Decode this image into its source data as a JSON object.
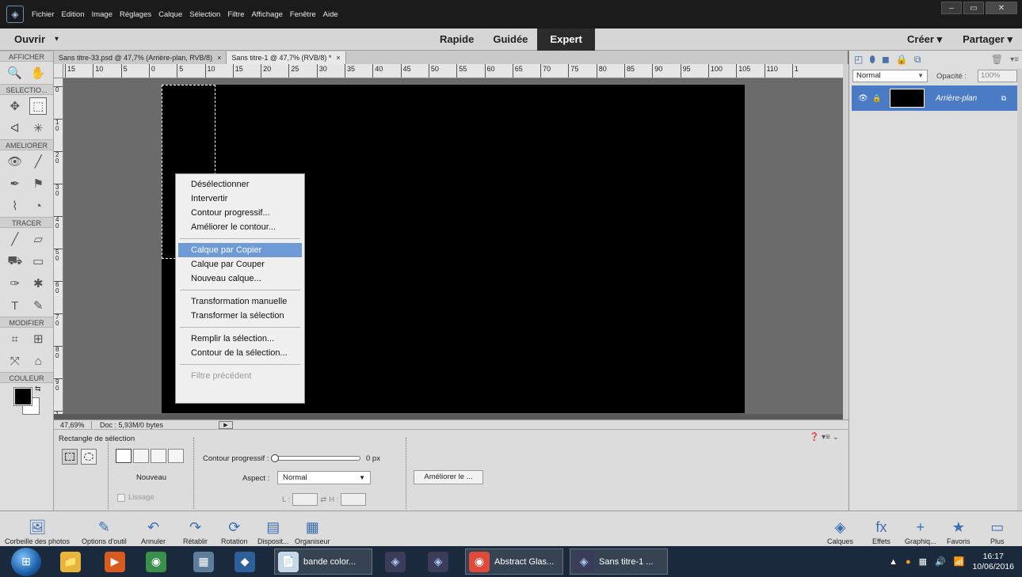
{
  "menubar": {
    "items": [
      "Fichier",
      "Edition",
      "Image",
      "Réglages",
      "Calque",
      "Sélection",
      "Filtre",
      "Affichage",
      "Fenêtre",
      "Aide"
    ],
    "window_controls": [
      "–",
      "▭",
      "✕"
    ]
  },
  "modebar": {
    "open_label": "Ouvrir",
    "tabs": [
      "Rapide",
      "Guidée",
      "Expert"
    ],
    "active_tab": "Expert",
    "create_label": "Créer",
    "share_label": "Partager"
  },
  "toolbox": {
    "sections": {
      "view": "AFFICHER",
      "select": "SELECTIO...",
      "enhance": "AMELIORER",
      "draw": "TRACER",
      "modify": "MODIFIER",
      "color": "COULEUR"
    },
    "icons": {
      "zoom": "🔍",
      "hand": "✋",
      "move": "✥",
      "marquee": "⬚",
      "lasso": "ᐊ",
      "magic_wand": "✳",
      "red_eye": "👁",
      "spot_heal": "╱",
      "smart_brush": "✒",
      "stamp": "⚑",
      "blur": "⌇",
      "sponge": "◔",
      "brush": "╱",
      "eraser": "▱",
      "paint_bucket": "⛟",
      "gradient": "▭",
      "eyedropper": "✑",
      "custom_shape": "✱",
      "text": "T",
      "pencil": "✎",
      "crop": "⌗",
      "recompose": "⊞",
      "straighten": "⤧",
      "content_move": "⌂",
      "swap_colors": "⇆"
    },
    "fg_color": "#000000",
    "bg_color": "#ffffff"
  },
  "document_tabs": [
    {
      "label": "Sans titre-33.psd @ 47,7% (Arrière-plan, RVB/8)",
      "close": "×"
    },
    {
      "label": "Sans titre-1 @ 47,7% (RVB/8) *",
      "close": "×"
    }
  ],
  "ruler": {
    "h_labels": [
      "15",
      "10",
      "5",
      "0",
      "5",
      "10",
      "15",
      "20",
      "25",
      "30",
      "35",
      "40",
      "45",
      "50",
      "55",
      "60",
      "65",
      "70",
      "75",
      "80",
      "85",
      "90",
      "95",
      "100",
      "105",
      "110",
      "1"
    ],
    "v_labels": [
      "0",
      "1\n0",
      "2\n0",
      "3\n0",
      "4\n0",
      "5\n0",
      "6\n0",
      "7\n0",
      "8\n0",
      "9\n0",
      "1"
    ]
  },
  "context_menu": {
    "groups": [
      [
        "Désélectionner",
        "Intervertir",
        "Contour progressif...",
        "Améliorer le contour..."
      ],
      [
        "Calque par Copier",
        "Calque par Couper",
        "Nouveau calque..."
      ],
      [
        "Transformation manuelle",
        "Transformer la sélection"
      ],
      [
        "Remplir la sélection...",
        "Contour de la sélection..."
      ],
      [
        "Filtre précédent"
      ]
    ],
    "highlighted": "Calque par Copier",
    "disabled": "Filtre précédent"
  },
  "statusbar": {
    "zoom": "47,69%",
    "doc": "Doc : 5,93M/0 bytes",
    "arrow": "▶"
  },
  "options": {
    "title": "Rectangle de sélection",
    "help_icons": "❓ ▾≡ ⌄",
    "mode_label": "Nouveau",
    "smoothing_label": "Lissage",
    "feather_label": "Contour progressif :",
    "feather_value": "0 px",
    "aspect_label": "Aspect :",
    "aspect_value": "Normal",
    "w_label": "L :",
    "h_label": "H :",
    "swap": "⇄",
    "refine_button": "Améliorer le ..."
  },
  "layers_panel": {
    "icons": [
      "◰",
      "⬮",
      "◼",
      "🔒",
      "⧉"
    ],
    "trash": "🗑",
    "menu": "▾≡",
    "blend_mode": "Normal",
    "opacity_label": "Opacité :",
    "opacity_value": "100%",
    "layer": {
      "name": "Arrière-plan",
      "eye": "👁",
      "lock": "🔒",
      "badge": "⧉"
    }
  },
  "bottombar": {
    "left": [
      {
        "label": "Corbeille des photos",
        "icon": "🖼"
      },
      {
        "label": "Options d'outil",
        "icon": "✎"
      },
      {
        "label": "Annuler",
        "icon": "↶"
      },
      {
        "label": "Rétablir",
        "icon": "↷"
      },
      {
        "label": "Rotation",
        "icon": "⟳"
      },
      {
        "label": "Disposit...",
        "icon": "▤"
      },
      {
        "label": "Organiseur",
        "icon": "▦"
      }
    ],
    "right": [
      {
        "label": "Calques",
        "icon": "◈"
      },
      {
        "label": "Effets",
        "icon": "fx"
      },
      {
        "label": "Graphiq...",
        "icon": "+"
      },
      {
        "label": "Favoris",
        "icon": "★"
      },
      {
        "label": "Plus",
        "icon": "▭"
      }
    ]
  },
  "taskbar": {
    "start_icon": "⊞",
    "apps": [
      {
        "icon": "📁",
        "bg": "#e8b53a"
      },
      {
        "icon": "▶",
        "bg": "#d95b1f"
      },
      {
        "icon": "◉",
        "bg": "#3a8f4a"
      },
      {
        "icon": "▦",
        "bg": "#5d7d9a"
      },
      {
        "icon": "◆",
        "bg": "#2d5f9a"
      }
    ],
    "labeled": [
      {
        "label": "bande color...",
        "icon": "📄"
      },
      {
        "label": "Abstract Glas...",
        "icon": "◉"
      },
      {
        "label": "Sans titre-1 ...",
        "icon": "◈"
      }
    ],
    "pe_icons": [
      "◈",
      "◈"
    ],
    "tray_icons": [
      "▲",
      "●",
      "▦",
      "🔊",
      "📶"
    ],
    "time": "16:17",
    "date": "10/06/2016"
  }
}
